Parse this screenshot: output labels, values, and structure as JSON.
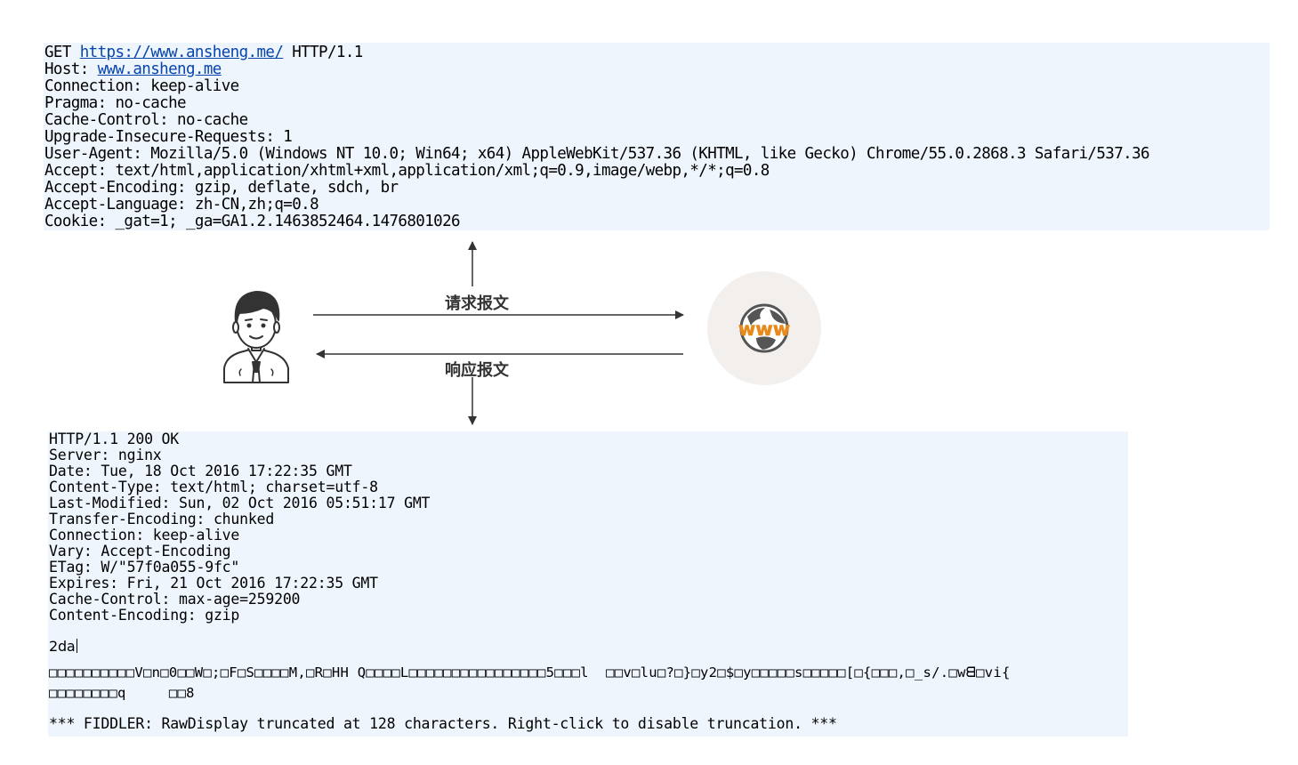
{
  "request": {
    "method": "GET",
    "url": "https://www.ansheng.me/",
    "version": "HTTP/1.1",
    "host_prefix": "Host: ",
    "host": "www.ansheng.me",
    "headers": [
      "Connection: keep-alive",
      "Pragma: no-cache",
      "Cache-Control: no-cache",
      "Upgrade-Insecure-Requests: 1",
      "User-Agent: Mozilla/5.0 (Windows NT 10.0; Win64; x64) AppleWebKit/537.36 (KHTML, like Gecko) Chrome/55.0.2868.3 Safari/537.36",
      "Accept: text/html,application/xhtml+xml,application/xml;q=0.9,image/webp,*/*;q=0.8",
      "Accept-Encoding: gzip, deflate, sdch, br",
      "Accept-Language: zh-CN,zh;q=0.8",
      "Cookie: _gat=1; _ga=GA1.2.1463852464.1476801026"
    ]
  },
  "labels": {
    "request_message": "请求报文",
    "response_message": "响应报文",
    "globe": "www"
  },
  "response": {
    "headers": [
      "HTTP/1.1 200 OK",
      "Server: nginx",
      "Date: Tue, 18 Oct 2016 17:22:35 GMT",
      "Content-Type: text/html; charset=utf-8",
      "Last-Modified: Sun, 02 Oct 2016 05:51:17 GMT",
      "Transfer-Encoding: chunked",
      "Connection: keep-alive",
      "Vary: Accept-Encoding",
      "ETag: W/\"57f0a055-9fc\"",
      "Expires: Fri, 21 Oct 2016 17:22:35 GMT",
      "Cache-Control: max-age=259200",
      "Content-Encoding: gzip"
    ],
    "chunk_size": "2da",
    "body_lines": [
      "□□□□□□□□□□V□n□0□□W□;□F□S□□□□M,□R□HH Q□□□□L□□□□□□□□□□□□□□□□5□□□l  □□v□lu□?□}□y2□$□y□□□□□s□□□□□[□{□□□,□_s/.□wᗺ□vi{",
      "□□□□□□□□q     □□8"
    ],
    "truncation_note": "*** FIDDLER: RawDisplay truncated at 128 characters. Right-click to disable truncation. ***"
  },
  "colors": {
    "panel_bg": "#eef5fc",
    "link": "#0645ad",
    "globe_circle": "#f2efed",
    "globe_text": "#e8891c",
    "globe_land": "#555555"
  },
  "icons": [
    "user-avatar-icon",
    "www-globe-icon",
    "arrow-up-icon",
    "arrow-down-icon",
    "arrow-right-icon",
    "arrow-left-icon"
  ]
}
